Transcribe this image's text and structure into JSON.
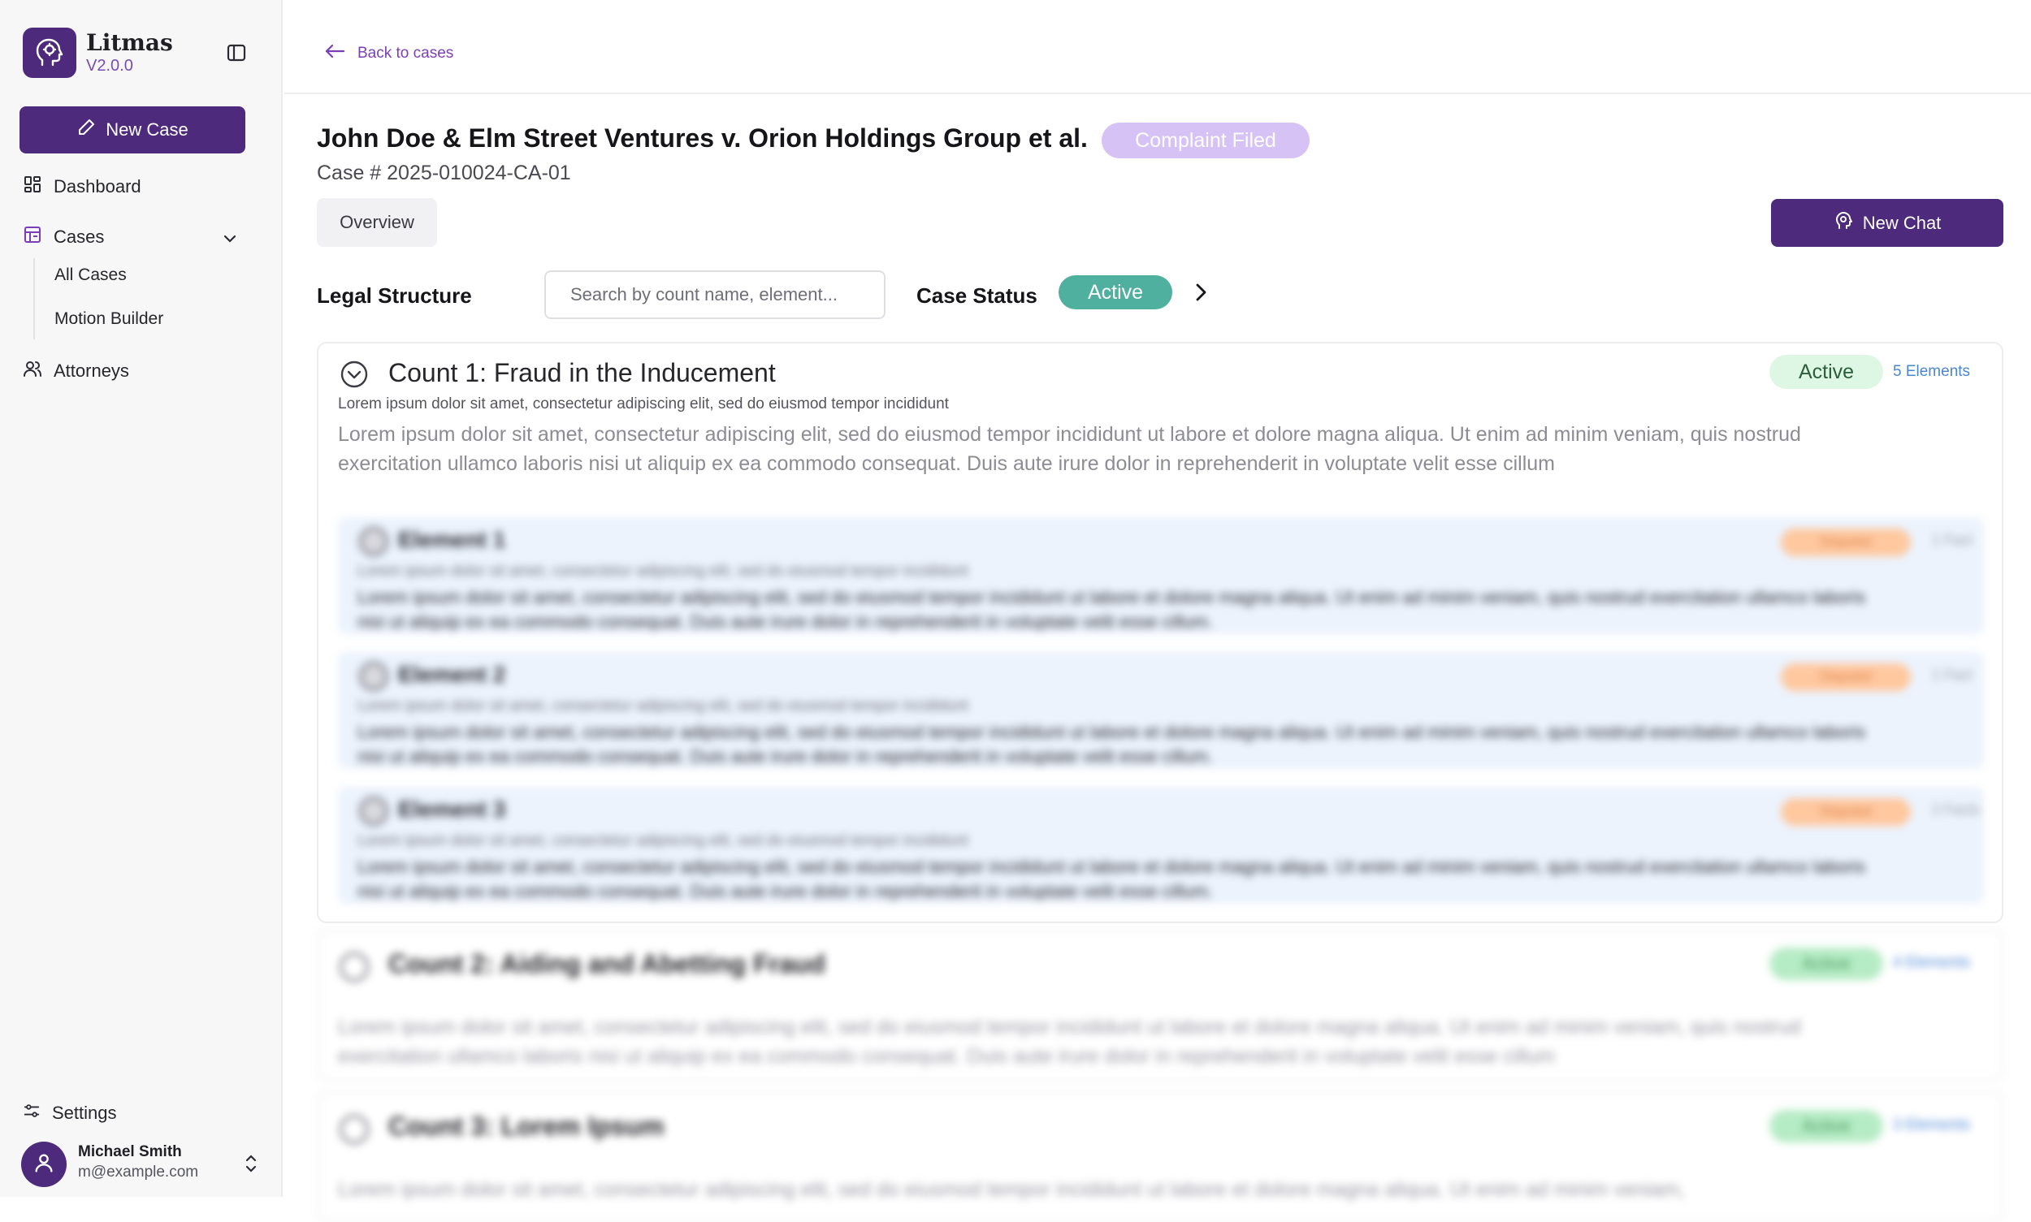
{
  "sidebar": {
    "app_name": "Litmas",
    "app_version": "V2.0.0",
    "new_case_label": "New Case",
    "nav": {
      "dashboard": "Dashboard",
      "cases": "Cases",
      "all_cases": "All Cases",
      "motion_builder": "Motion Builder",
      "attorneys": "Attorneys",
      "settings": "Settings"
    },
    "user": {
      "name": "Michael Smith",
      "email": "m@example.com"
    }
  },
  "header": {
    "back_label": "Back to cases"
  },
  "case": {
    "title": "John Doe & Elm Street Ventures v. Orion Holdings Group et al.",
    "status_badge": "Complaint Filed",
    "number": "Case # 2025-010024-CA-01",
    "tab_overview": "Overview",
    "new_chat_label": "New Chat"
  },
  "legal_structure": {
    "label": "Legal Structure",
    "search_placeholder": "Search by count name, element...",
    "case_status_label": "Case Status",
    "case_status_value": "Active"
  },
  "counts": [
    {
      "title": "Count 1: Fraud in the Inducement",
      "status": "Active",
      "elements_label": "5 Elements",
      "subtitle": "Lorem ipsum dolor sit amet, consectetur adipiscing elit, sed do eiusmod tempor incididunt",
      "description": "Lorem ipsum dolor sit amet, consectetur adipiscing elit, sed do eiusmod tempor incididunt ut labore et dolore magna aliqua. Ut enim ad minim veniam, quis nostrud exercitation ullamco laboris nisi ut aliquip ex ea commodo consequat. Duis aute irure dolor in reprehenderit in voluptate velit esse cillum",
      "elements": [
        {
          "title": "Element 1",
          "badge": "Disputed",
          "meta": "1 Fact",
          "subtitle": "Lorem ipsum dolor sit amet, consectetur adipiscing elit, sed do eiusmod tempor incididunt",
          "description": "Lorem ipsum dolor sit amet, consectetur adipiscing elit, sed do eiusmod tempor incididunt ut labore et dolore magna aliqua. Ut enim ad minim veniam, quis nostrud exercitation ullamco laboris nisi ut aliquip ex ea commodo consequat. Duis aute irure dolor in reprehenderit in voluptate velit esse cillum."
        },
        {
          "title": "Element 2",
          "badge": "Disputed",
          "meta": "1 Fact",
          "subtitle": "Lorem ipsum dolor sit amet, consectetur adipiscing elit, sed do eiusmod tempor incididunt",
          "description": "Lorem ipsum dolor sit amet, consectetur adipiscing elit, sed do eiusmod tempor incididunt ut labore et dolore magna aliqua. Ut enim ad minim veniam, quis nostrud exercitation ullamco laboris nisi ut aliquip ex ea commodo consequat. Duis aute irure dolor in reprehenderit in voluptate velit esse cillum."
        },
        {
          "title": "Element 3",
          "badge": "Disputed",
          "meta": "2 Facts",
          "subtitle": "Lorem ipsum dolor sit amet, consectetur adipiscing elit, sed do eiusmod tempor incididunt",
          "description": "Lorem ipsum dolor sit amet, consectetur adipiscing elit, sed do eiusmod tempor incididunt ut labore et dolore magna aliqua. Ut enim ad minim veniam, quis nostrud exercitation ullamco laboris nisi ut aliquip ex ea commodo consequat. Duis aute irure dolor in reprehenderit in voluptate velit esse cillum."
        }
      ]
    },
    {
      "title": "Count 2: Aiding and Abetting Fraud",
      "status": "Active",
      "elements_label": "4 Elements",
      "description": "Lorem ipsum dolor sit amet, consectetur adipiscing elit, sed do eiusmod tempor incididunt ut labore et dolore magna aliqua. Ut enim ad minim veniam, quis nostrud exercitation ullamco laboris nisi ut aliquip ex ea commodo consequat. Duis aute irure dolor in reprehenderit in voluptate velit esse cillum"
    },
    {
      "title": "Count 3: Lorem Ipsum",
      "status": "Active",
      "elements_label": "3 Elements",
      "description": "Lorem ipsum dolor sit amet, consectetur adipiscing elit, sed do eiusmod tempor incididunt ut labore et dolore magna aliqua. Ut enim ad minim veniam,"
    }
  ],
  "colors": {
    "brand": "#4d2a7c",
    "accent_link": "#7a3fb8",
    "case_status_active": "#4fb0a0",
    "badge_complaint": "#d7c2f5",
    "count_active_bg": "#ddf7e4",
    "element_bg": "#ecf3fd",
    "disputed_badge": "#ffc89f"
  },
  "icons": [
    "logo-icon",
    "sidebar-toggle-icon",
    "pencil-icon",
    "dashboard-icon",
    "cases-icon",
    "chevron-down-icon",
    "attorneys-icon",
    "settings-icon",
    "user-icon",
    "chevron-updown-icon",
    "arrow-left-icon",
    "chat-head-icon",
    "chevron-right-icon",
    "chevron-circle-icon"
  ]
}
